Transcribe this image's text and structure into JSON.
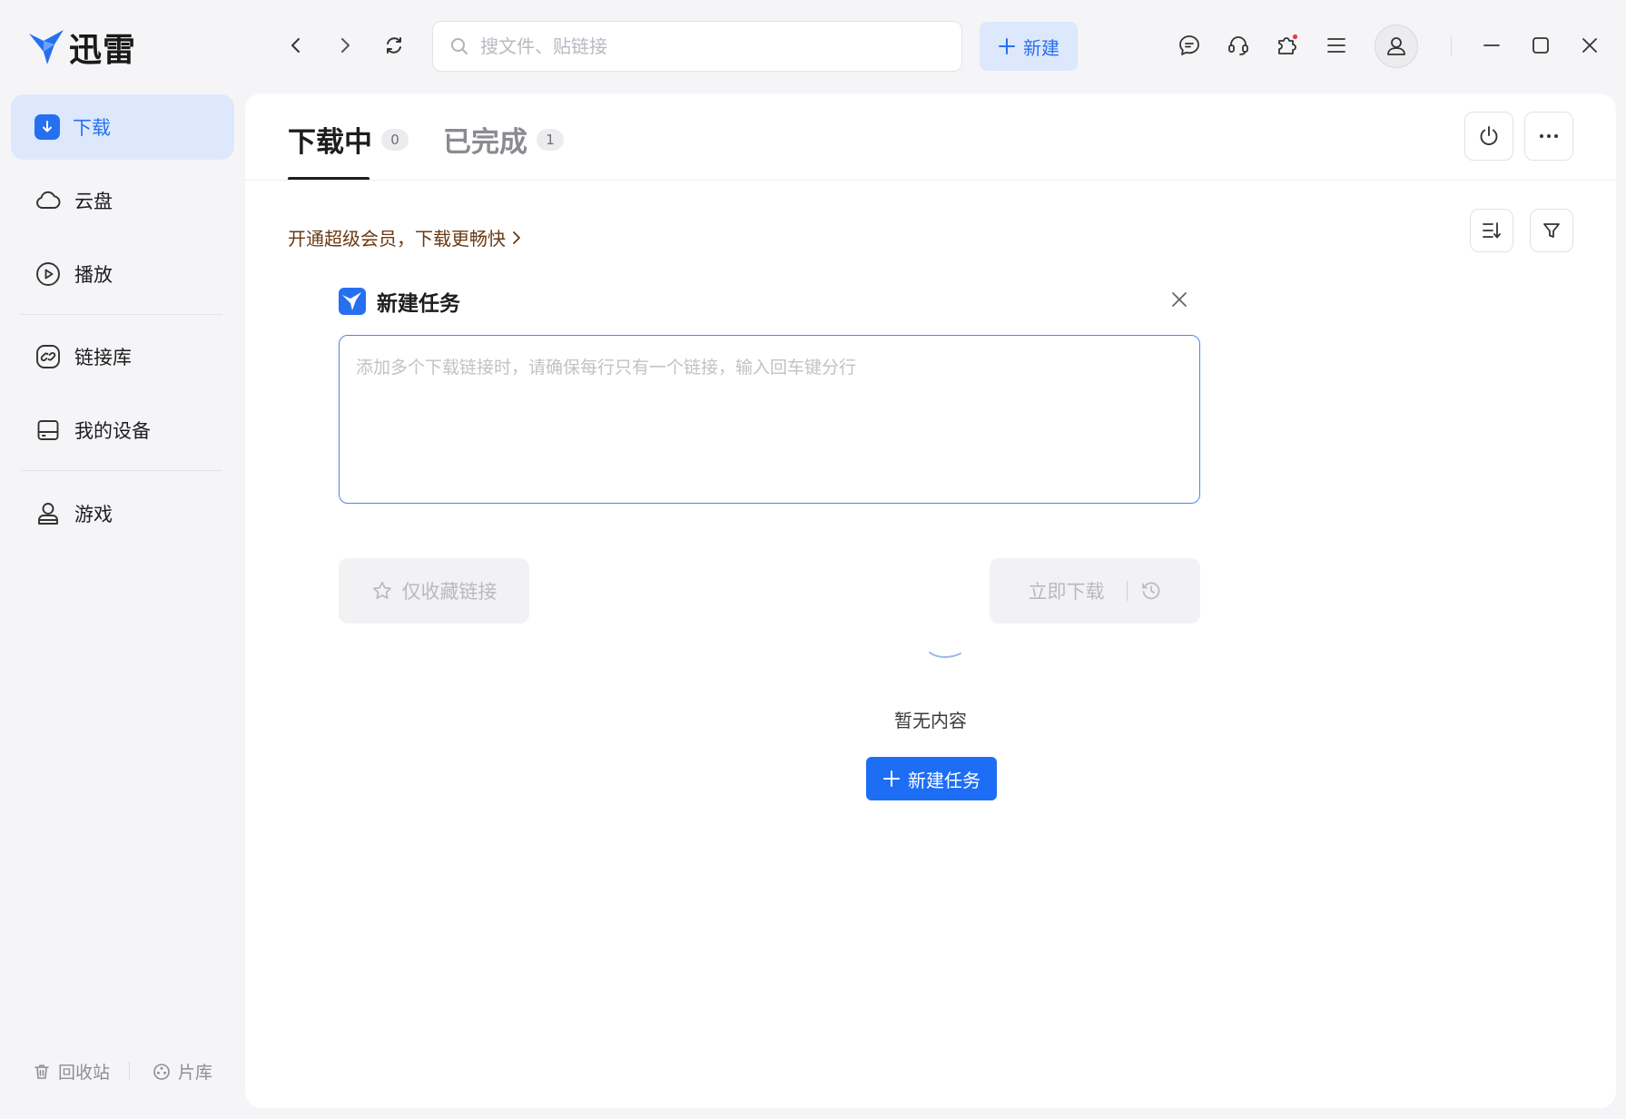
{
  "app": {
    "name": "迅雷"
  },
  "search": {
    "placeholder": "搜文件、贴链接",
    "value": ""
  },
  "header": {
    "new_label": "新建"
  },
  "sidebar": {
    "items": [
      {
        "label": "下载"
      },
      {
        "label": "云盘"
      },
      {
        "label": "播放"
      },
      {
        "label": "链接库"
      },
      {
        "label": "我的设备"
      },
      {
        "label": "游戏"
      }
    ],
    "bottom": {
      "recycle": "回收站",
      "library": "片库"
    }
  },
  "tabs": [
    {
      "label": "下载中",
      "count": "0"
    },
    {
      "label": "已完成",
      "count": "1"
    }
  ],
  "promo": {
    "text": "开通超级会员，下载更畅快"
  },
  "dialog": {
    "title": "新建任务",
    "textarea_placeholder": "添加多个下载链接时，请确保每行只有一个链接，输入回车键分行",
    "textarea_value": "",
    "favorite_label": "仅收藏链接",
    "download_label": "立即下载"
  },
  "empty": {
    "text": "暂无内容",
    "button_label": "新建任务"
  },
  "colors": {
    "accent": "#2670f0",
    "accent_light": "#dde8fd",
    "promo": "#6a3a14"
  }
}
